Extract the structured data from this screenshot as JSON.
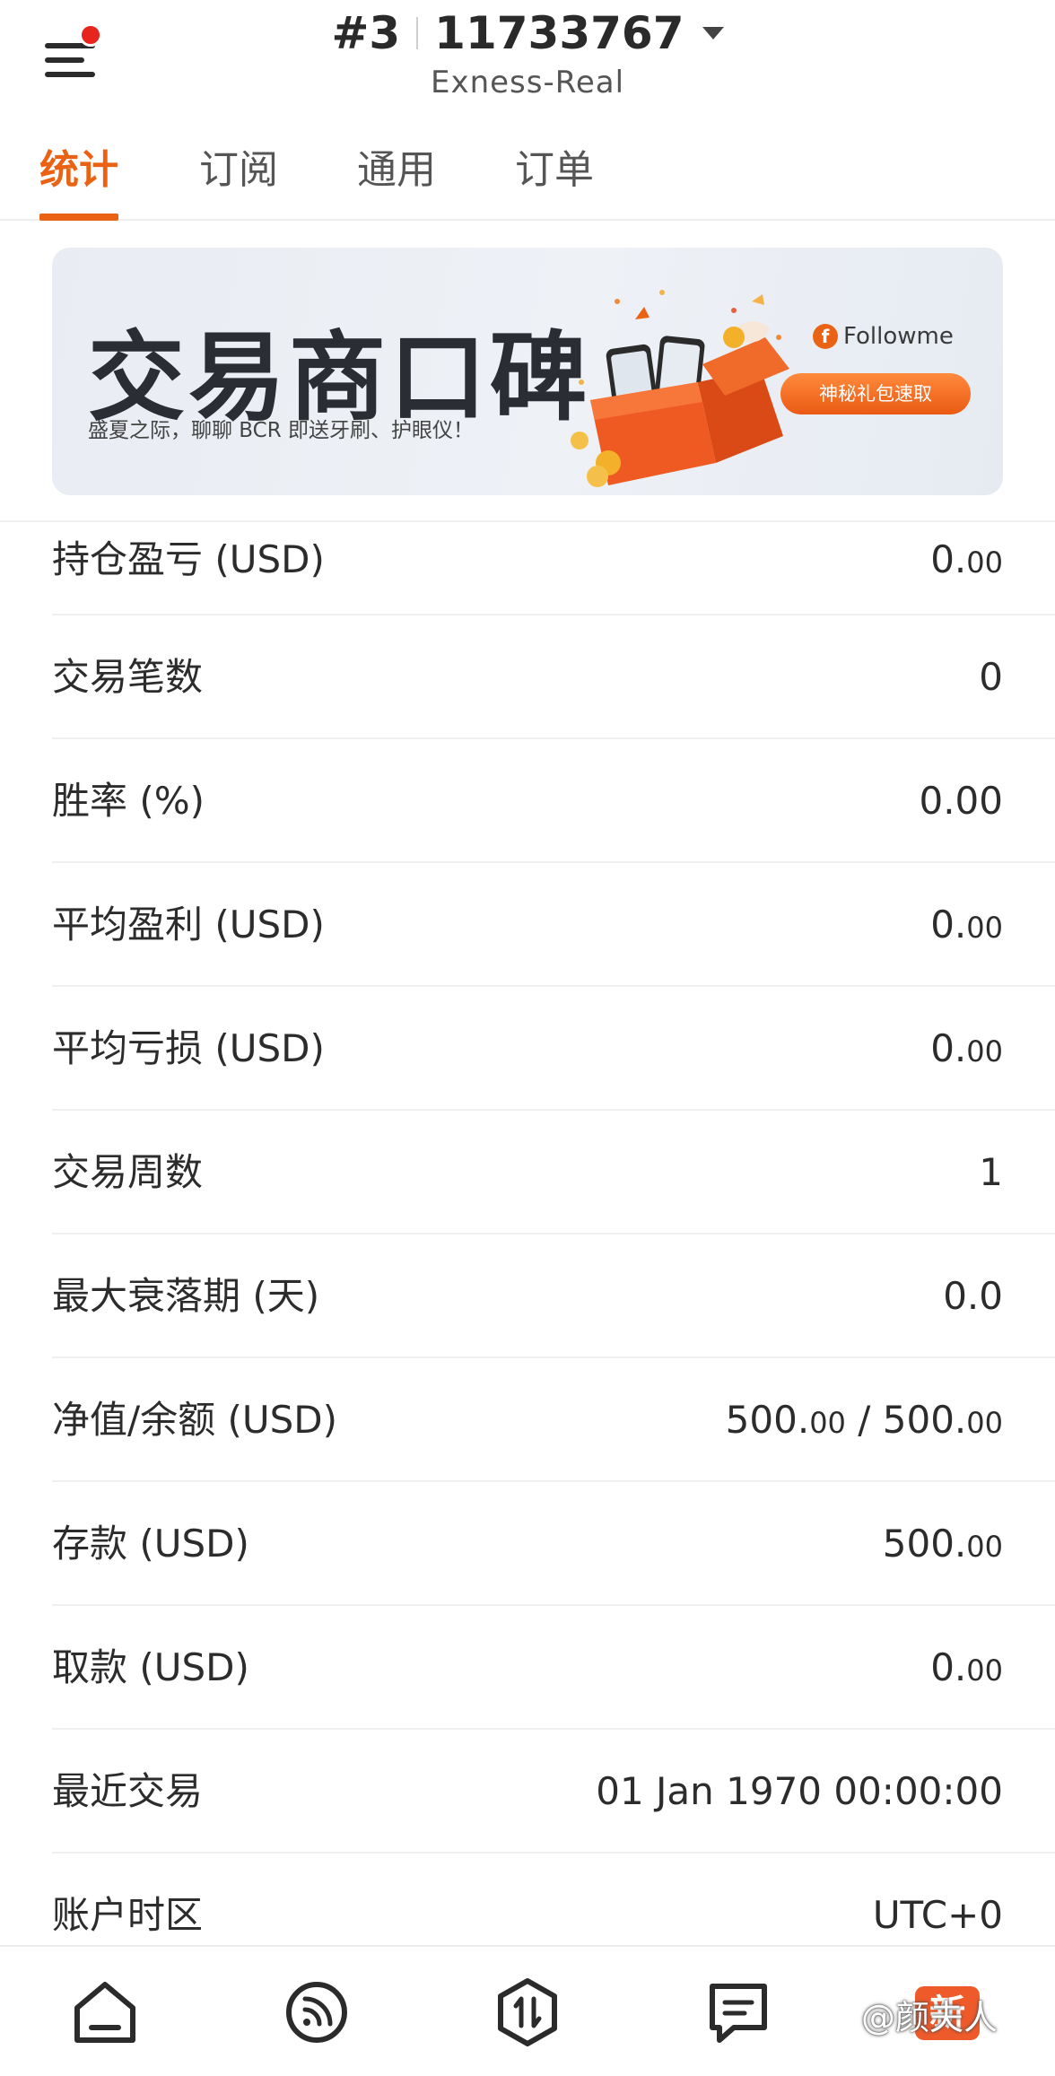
{
  "header": {
    "account_rank": "#3",
    "account_number": "11733767",
    "server": "Exness-Real"
  },
  "tabs": [
    {
      "label": "统计",
      "active": true
    },
    {
      "label": "订阅",
      "active": false
    },
    {
      "label": "通用",
      "active": false
    },
    {
      "label": "订单",
      "active": false
    }
  ],
  "banner": {
    "title": "交易商口碑",
    "subtitle": "盛夏之际，聊聊 BCR 即送牙刷、护眼仪！",
    "brand": "Followme",
    "cta": "神秘礼包速取"
  },
  "stats": [
    {
      "label": "持仓盈亏 (USD)",
      "value_main": "0.",
      "value_small": "00"
    },
    {
      "label": "交易笔数",
      "value_main": "0",
      "value_small": ""
    },
    {
      "label": "胜率 (%)",
      "value_main": "0.00",
      "value_small": ""
    },
    {
      "label": "平均盈利 (USD)",
      "value_main": "0.",
      "value_small": "00"
    },
    {
      "label": "平均亏损 (USD)",
      "value_main": "0.",
      "value_small": "00"
    },
    {
      "label": "交易周数",
      "value_main": "1",
      "value_small": ""
    },
    {
      "label": "最大衰落期 (天)",
      "value_main": "0.0",
      "value_small": ""
    },
    {
      "label": "净值/余额 (USD)",
      "value_main": "500.",
      "value_small": "00",
      "value_main2": " / 500.",
      "value_small2": "00"
    },
    {
      "label": "存款 (USD)",
      "value_main": "500.",
      "value_small": "00"
    },
    {
      "label": "取款 (USD)",
      "value_main": "0.",
      "value_small": "00"
    },
    {
      "label": "最近交易",
      "value_main": "01 Jan 1970 00:00:00",
      "value_small": ""
    },
    {
      "label": "账户时区",
      "value_main": "UTC+0",
      "value_small": ""
    }
  ],
  "bottom_nav": {
    "items": [
      "home-icon",
      "feed-icon",
      "trade-icon",
      "messages-icon"
    ],
    "new_badge": "新",
    "watermark": "@颜夫人"
  },
  "colors": {
    "accent": "#ea6314",
    "notification": "#e8251c"
  }
}
